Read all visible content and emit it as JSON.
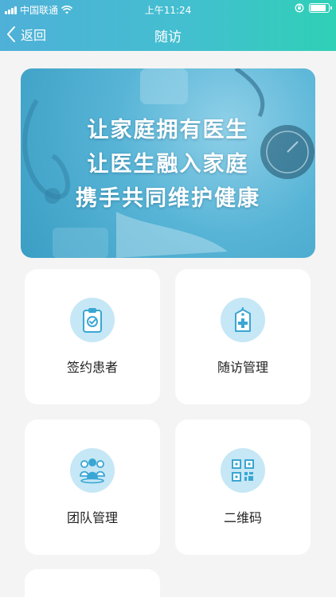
{
  "status_bar": {
    "carrier": "中国联通",
    "time": "上午11:24",
    "battery_level": 0.9
  },
  "nav": {
    "back_label": "返回",
    "title": "随访"
  },
  "banner": {
    "lines": [
      "让家庭拥有医生",
      "让医生融入家庭",
      "携手共同维护健康"
    ]
  },
  "menu": [
    {
      "label": "签约患者",
      "icon": "clipboard-check-icon"
    },
    {
      "label": "随访管理",
      "icon": "tag-medical-icon"
    },
    {
      "label": "团队管理",
      "icon": "team-icon"
    },
    {
      "label": "二维码",
      "icon": "qr-code-icon"
    }
  ],
  "colors": {
    "header_start": "#4fb0d8",
    "header_end": "#2fd0b6",
    "icon_bg": "#c6e7f5",
    "icon_fg": "#3aa6d4"
  }
}
